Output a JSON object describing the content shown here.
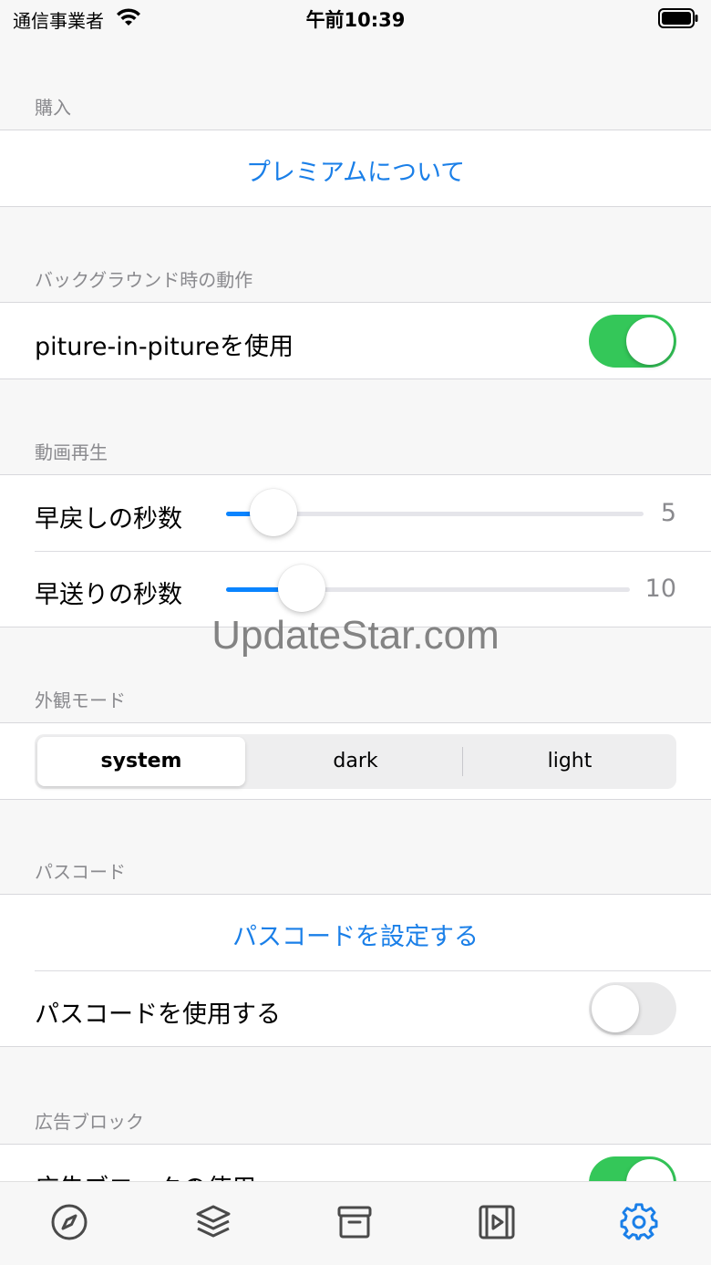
{
  "status_bar": {
    "carrier": "通信事業者",
    "time": "午前10:39"
  },
  "sections": {
    "purchase": {
      "header": "購入",
      "premium_link": "プレミアムについて"
    },
    "background": {
      "header": "バックグラウンド時の動作",
      "pip_label": "piture-in-pitureを使用",
      "pip_enabled": true
    },
    "playback": {
      "header": "動画再生",
      "rewind_label": "早戻しの秒数",
      "rewind_value": "5",
      "forward_label": "早送りの秒数",
      "forward_value": "10"
    },
    "appearance": {
      "header": "外観モード",
      "options": [
        "system",
        "dark",
        "light"
      ],
      "selected": "system"
    },
    "passcode": {
      "header": "パスコード",
      "set_link": "パスコードを設定する",
      "use_label": "パスコードを使用する",
      "use_enabled": false
    },
    "adblock": {
      "header": "広告ブロック",
      "use_label": "広告ブロックの使用",
      "use_enabled": true
    }
  },
  "watermark": "UpdateStar.com",
  "tab_bar": {
    "items": [
      "compass-icon",
      "layers-icon",
      "archive-icon",
      "video-icon",
      "gear-icon"
    ],
    "active": "gear-icon",
    "active_color": "#1a7fe8",
    "inactive_color": "#4a4a4a"
  },
  "colors": {
    "accent": "#1a7fe8",
    "toggle_on": "#34c759",
    "slider_fill": "#0a84ff"
  }
}
